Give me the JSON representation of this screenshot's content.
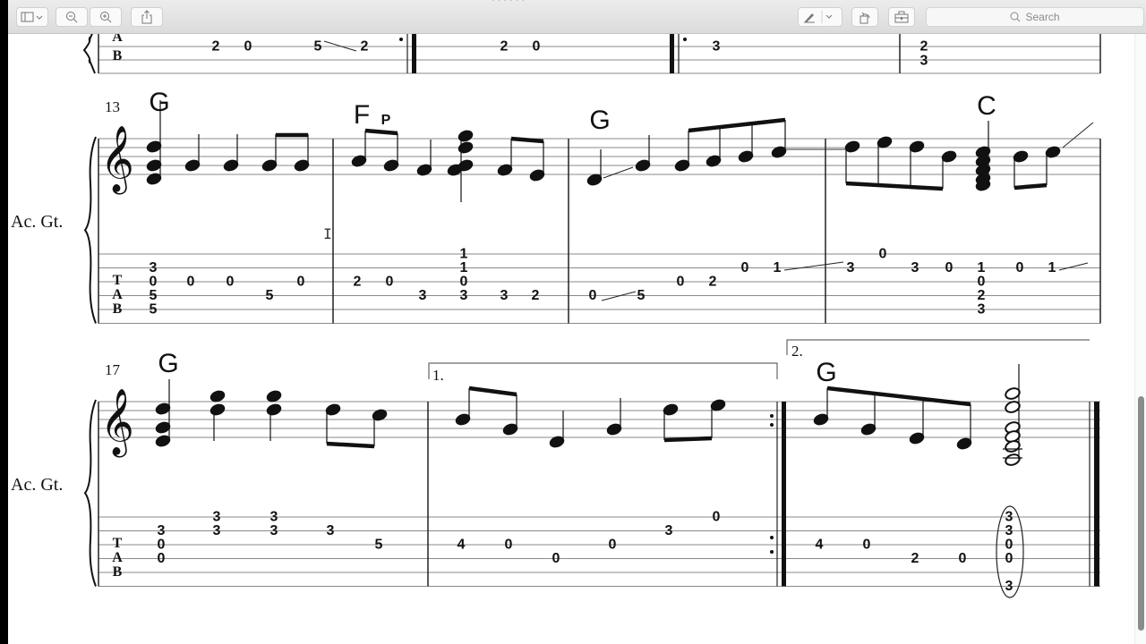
{
  "window": {
    "title_fragment": "· · · · · ·",
    "toolbar": {
      "sidebar_toggle": "sidebar-toggle",
      "zoom_out": "zoom-out",
      "zoom_in": "zoom-in",
      "share": "share",
      "markup": "markup",
      "rotate": "rotate",
      "toolbox": "toolbox",
      "search_placeholder": "Search"
    }
  },
  "score": {
    "instrument": "Ac. Gt.",
    "tab_label": [
      "T",
      "A",
      "B"
    ],
    "partial_row": {
      "measures": [
        {
          "tab": [
            {
              "string": 4,
              "fret": "2"
            },
            {
              "string": 4,
              "fret": "0"
            },
            {
              "string": 4,
              "fret": "5"
            },
            {
              "string": 4,
              "fret": "2"
            }
          ],
          "slide": [
            2,
            3
          ],
          "end": "repeat-end"
        },
        {
          "tab": [
            {
              "string": 4,
              "fret": "2"
            },
            {
              "string": 4,
              "fret": "0"
            }
          ],
          "end": "final"
        },
        {
          "tab": [
            {
              "string": 4,
              "fret": "3"
            }
          ],
          "start": "repeat-start"
        },
        {
          "tab": [
            {
              "string": 4,
              "fret": "2"
            },
            {
              "string": 5,
              "fret": "3"
            }
          ]
        }
      ]
    },
    "systems": [
      {
        "measure_number": "13",
        "measures": [
          {
            "chord": "G",
            "tab": [
              {
                "col": 0,
                "notes": [
                  {
                    "s": 2,
                    "f": "3"
                  },
                  {
                    "s": 3,
                    "f": "0"
                  },
                  {
                    "s": 4,
                    "f": "5"
                  },
                  {
                    "s": 5,
                    "f": "5"
                  }
                ]
              },
              {
                "col": 1,
                "notes": [
                  {
                    "s": 3,
                    "f": "0"
                  }
                ]
              },
              {
                "col": 2,
                "notes": [
                  {
                    "s": 3,
                    "f": "0"
                  }
                ]
              },
              {
                "col": 3,
                "notes": [
                  {
                    "s": 4,
                    "f": "5"
                  }
                ]
              },
              {
                "col": 4,
                "notes": [
                  {
                    "s": 3,
                    "f": "0"
                  }
                ]
              }
            ]
          },
          {
            "chord": "F",
            "annotation": "P",
            "tab": [
              {
                "col": 0,
                "notes": [
                  {
                    "s": 3,
                    "f": "2"
                  }
                ]
              },
              {
                "col": 1,
                "notes": [
                  {
                    "s": 3,
                    "f": "0"
                  }
                ]
              },
              {
                "col": 2,
                "notes": [
                  {
                    "s": 4,
                    "f": "3"
                  }
                ]
              },
              {
                "col": 3,
                "notes": [
                  {
                    "s": 1,
                    "f": "1"
                  },
                  {
                    "s": 2,
                    "f": "1"
                  },
                  {
                    "s": 3,
                    "f": "0"
                  },
                  {
                    "s": 4,
                    "f": "3"
                  }
                ]
              },
              {
                "col": 4,
                "notes": [
                  {
                    "s": 4,
                    "f": "3"
                  }
                ]
              },
              {
                "col": 5,
                "notes": [
                  {
                    "s": 4,
                    "f": "2"
                  }
                ]
              }
            ]
          },
          {
            "chord": "G",
            "tab": [
              {
                "col": 0,
                "notes": [
                  {
                    "s": 4,
                    "f": "0"
                  }
                ]
              },
              {
                "col": 1,
                "notes": [
                  {
                    "s": 4,
                    "f": "5"
                  }
                ]
              },
              {
                "col": 2,
                "notes": [
                  {
                    "s": 3,
                    "f": "0"
                  }
                ]
              },
              {
                "col": 3,
                "notes": [
                  {
                    "s": 3,
                    "f": "2"
                  }
                ]
              },
              {
                "col": 4,
                "notes": [
                  {
                    "s": 2,
                    "f": "0"
                  }
                ]
              },
              {
                "col": 5,
                "notes": [
                  {
                    "s": 2,
                    "f": "1"
                  }
                ]
              }
            ]
          },
          {
            "chord": "C",
            "tab": [
              {
                "col": 0,
                "notes": [
                  {
                    "s": 2,
                    "f": "3"
                  }
                ]
              },
              {
                "col": 1,
                "notes": [
                  {
                    "s": 1,
                    "f": "0"
                  }
                ]
              },
              {
                "col": 2,
                "notes": [
                  {
                    "s": 2,
                    "f": "3"
                  }
                ]
              },
              {
                "col": 3,
                "notes": [
                  {
                    "s": 2,
                    "f": "0"
                  }
                ]
              },
              {
                "col": 4,
                "notes": [
                  {
                    "s": 2,
                    "f": "1"
                  },
                  {
                    "s": 3,
                    "f": "0"
                  },
                  {
                    "s": 4,
                    "f": "2"
                  },
                  {
                    "s": 5,
                    "f": "3"
                  }
                ]
              },
              {
                "col": 5,
                "notes": [
                  {
                    "s": 2,
                    "f": "0"
                  }
                ]
              },
              {
                "col": 6,
                "notes": [
                  {
                    "s": 2,
                    "f": "1"
                  }
                ]
              }
            ]
          }
        ]
      },
      {
        "measure_number": "17",
        "measures": [
          {
            "chord": "G",
            "tab": [
              {
                "col": 0,
                "notes": [
                  {
                    "s": 2,
                    "f": "3"
                  },
                  {
                    "s": 3,
                    "f": "0"
                  },
                  {
                    "s": 4,
                    "f": "0"
                  }
                ]
              },
              {
                "col": 1,
                "notes": [
                  {
                    "s": 1,
                    "f": "3"
                  },
                  {
                    "s": 2,
                    "f": "3"
                  }
                ]
              },
              {
                "col": 2,
                "notes": [
                  {
                    "s": 1,
                    "f": "3"
                  },
                  {
                    "s": 2,
                    "f": "3"
                  }
                ]
              },
              {
                "col": 3,
                "notes": [
                  {
                    "s": 2,
                    "f": "3"
                  }
                ]
              },
              {
                "col": 4,
                "notes": [
                  {
                    "s": 3,
                    "f": "5"
                  }
                ]
              }
            ]
          },
          {
            "ending": "1.",
            "tab": [
              {
                "col": 0,
                "notes": [
                  {
                    "s": 3,
                    "f": "4"
                  }
                ]
              },
              {
                "col": 1,
                "notes": [
                  {
                    "s": 3,
                    "f": "0"
                  }
                ]
              },
              {
                "col": 2,
                "notes": [
                  {
                    "s": 4,
                    "f": "0"
                  }
                ]
              },
              {
                "col": 3,
                "notes": [
                  {
                    "s": 3,
                    "f": "0"
                  }
                ]
              },
              {
                "col": 4,
                "notes": [
                  {
                    "s": 2,
                    "f": "3"
                  }
                ]
              },
              {
                "col": 5,
                "notes": [
                  {
                    "s": 1,
                    "f": "0"
                  }
                ]
              }
            ]
          },
          {
            "ending": "2.",
            "chord": "G",
            "tab": [
              {
                "col": 0,
                "notes": [
                  {
                    "s": 3,
                    "f": "4"
                  }
                ]
              },
              {
                "col": 1,
                "notes": [
                  {
                    "s": 3,
                    "f": "0"
                  }
                ]
              },
              {
                "col": 2,
                "notes": [
                  {
                    "s": 4,
                    "f": "2"
                  }
                ]
              },
              {
                "col": 3,
                "notes": [
                  {
                    "s": 4,
                    "f": "0"
                  }
                ]
              },
              {
                "col": 4,
                "notes": [
                  {
                    "s": 1,
                    "f": "3"
                  },
                  {
                    "s": 2,
                    "f": "3"
                  },
                  {
                    "s": 3,
                    "f": "0"
                  },
                  {
                    "s": 4,
                    "f": "0"
                  },
                  {
                    "s": 6,
                    "f": "3"
                  }
                ],
                "circled": true
              }
            ]
          }
        ]
      }
    ]
  },
  "colors": {
    "ink": "#111111",
    "staff_line": "#8a8a8a",
    "toolbar": "#e4e4e4",
    "scroll_thumb": "#8c8c8c"
  }
}
